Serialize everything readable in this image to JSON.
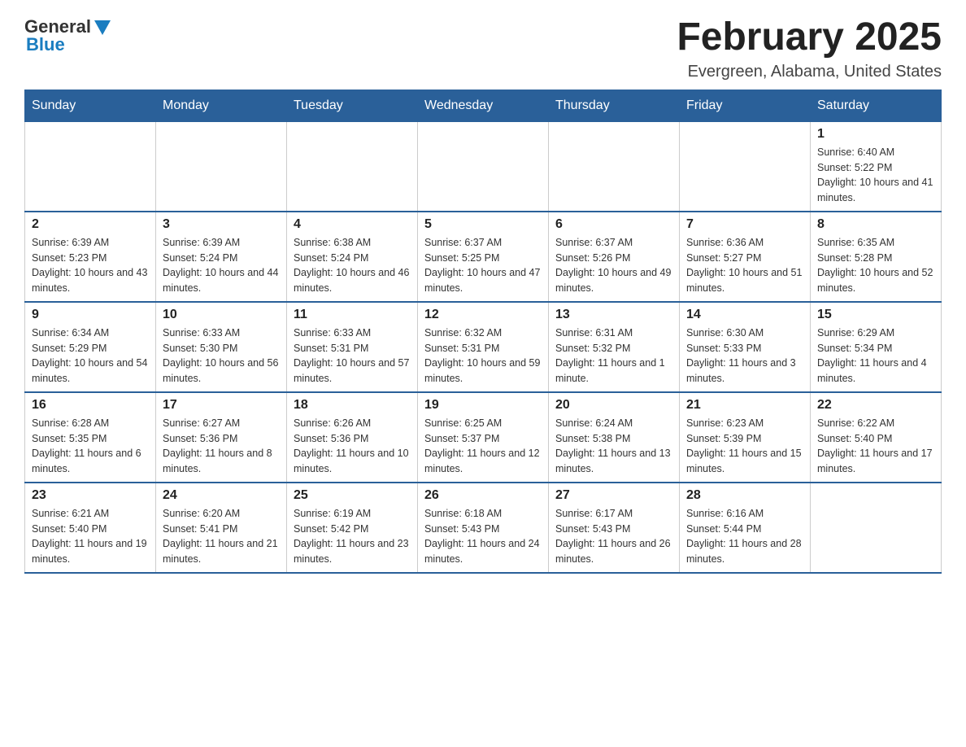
{
  "header": {
    "logo_general": "General",
    "logo_blue": "Blue",
    "month_title": "February 2025",
    "location": "Evergreen, Alabama, United States"
  },
  "weekdays": [
    "Sunday",
    "Monday",
    "Tuesday",
    "Wednesday",
    "Thursday",
    "Friday",
    "Saturday"
  ],
  "weeks": [
    [
      {
        "day": "",
        "info": ""
      },
      {
        "day": "",
        "info": ""
      },
      {
        "day": "",
        "info": ""
      },
      {
        "day": "",
        "info": ""
      },
      {
        "day": "",
        "info": ""
      },
      {
        "day": "",
        "info": ""
      },
      {
        "day": "1",
        "info": "Sunrise: 6:40 AM\nSunset: 5:22 PM\nDaylight: 10 hours and 41 minutes."
      }
    ],
    [
      {
        "day": "2",
        "info": "Sunrise: 6:39 AM\nSunset: 5:23 PM\nDaylight: 10 hours and 43 minutes."
      },
      {
        "day": "3",
        "info": "Sunrise: 6:39 AM\nSunset: 5:24 PM\nDaylight: 10 hours and 44 minutes."
      },
      {
        "day": "4",
        "info": "Sunrise: 6:38 AM\nSunset: 5:24 PM\nDaylight: 10 hours and 46 minutes."
      },
      {
        "day": "5",
        "info": "Sunrise: 6:37 AM\nSunset: 5:25 PM\nDaylight: 10 hours and 47 minutes."
      },
      {
        "day": "6",
        "info": "Sunrise: 6:37 AM\nSunset: 5:26 PM\nDaylight: 10 hours and 49 minutes."
      },
      {
        "day": "7",
        "info": "Sunrise: 6:36 AM\nSunset: 5:27 PM\nDaylight: 10 hours and 51 minutes."
      },
      {
        "day": "8",
        "info": "Sunrise: 6:35 AM\nSunset: 5:28 PM\nDaylight: 10 hours and 52 minutes."
      }
    ],
    [
      {
        "day": "9",
        "info": "Sunrise: 6:34 AM\nSunset: 5:29 PM\nDaylight: 10 hours and 54 minutes."
      },
      {
        "day": "10",
        "info": "Sunrise: 6:33 AM\nSunset: 5:30 PM\nDaylight: 10 hours and 56 minutes."
      },
      {
        "day": "11",
        "info": "Sunrise: 6:33 AM\nSunset: 5:31 PM\nDaylight: 10 hours and 57 minutes."
      },
      {
        "day": "12",
        "info": "Sunrise: 6:32 AM\nSunset: 5:31 PM\nDaylight: 10 hours and 59 minutes."
      },
      {
        "day": "13",
        "info": "Sunrise: 6:31 AM\nSunset: 5:32 PM\nDaylight: 11 hours and 1 minute."
      },
      {
        "day": "14",
        "info": "Sunrise: 6:30 AM\nSunset: 5:33 PM\nDaylight: 11 hours and 3 minutes."
      },
      {
        "day": "15",
        "info": "Sunrise: 6:29 AM\nSunset: 5:34 PM\nDaylight: 11 hours and 4 minutes."
      }
    ],
    [
      {
        "day": "16",
        "info": "Sunrise: 6:28 AM\nSunset: 5:35 PM\nDaylight: 11 hours and 6 minutes."
      },
      {
        "day": "17",
        "info": "Sunrise: 6:27 AM\nSunset: 5:36 PM\nDaylight: 11 hours and 8 minutes."
      },
      {
        "day": "18",
        "info": "Sunrise: 6:26 AM\nSunset: 5:36 PM\nDaylight: 11 hours and 10 minutes."
      },
      {
        "day": "19",
        "info": "Sunrise: 6:25 AM\nSunset: 5:37 PM\nDaylight: 11 hours and 12 minutes."
      },
      {
        "day": "20",
        "info": "Sunrise: 6:24 AM\nSunset: 5:38 PM\nDaylight: 11 hours and 13 minutes."
      },
      {
        "day": "21",
        "info": "Sunrise: 6:23 AM\nSunset: 5:39 PM\nDaylight: 11 hours and 15 minutes."
      },
      {
        "day": "22",
        "info": "Sunrise: 6:22 AM\nSunset: 5:40 PM\nDaylight: 11 hours and 17 minutes."
      }
    ],
    [
      {
        "day": "23",
        "info": "Sunrise: 6:21 AM\nSunset: 5:40 PM\nDaylight: 11 hours and 19 minutes."
      },
      {
        "day": "24",
        "info": "Sunrise: 6:20 AM\nSunset: 5:41 PM\nDaylight: 11 hours and 21 minutes."
      },
      {
        "day": "25",
        "info": "Sunrise: 6:19 AM\nSunset: 5:42 PM\nDaylight: 11 hours and 23 minutes."
      },
      {
        "day": "26",
        "info": "Sunrise: 6:18 AM\nSunset: 5:43 PM\nDaylight: 11 hours and 24 minutes."
      },
      {
        "day": "27",
        "info": "Sunrise: 6:17 AM\nSunset: 5:43 PM\nDaylight: 11 hours and 26 minutes."
      },
      {
        "day": "28",
        "info": "Sunrise: 6:16 AM\nSunset: 5:44 PM\nDaylight: 11 hours and 28 minutes."
      },
      {
        "day": "",
        "info": ""
      }
    ]
  ]
}
